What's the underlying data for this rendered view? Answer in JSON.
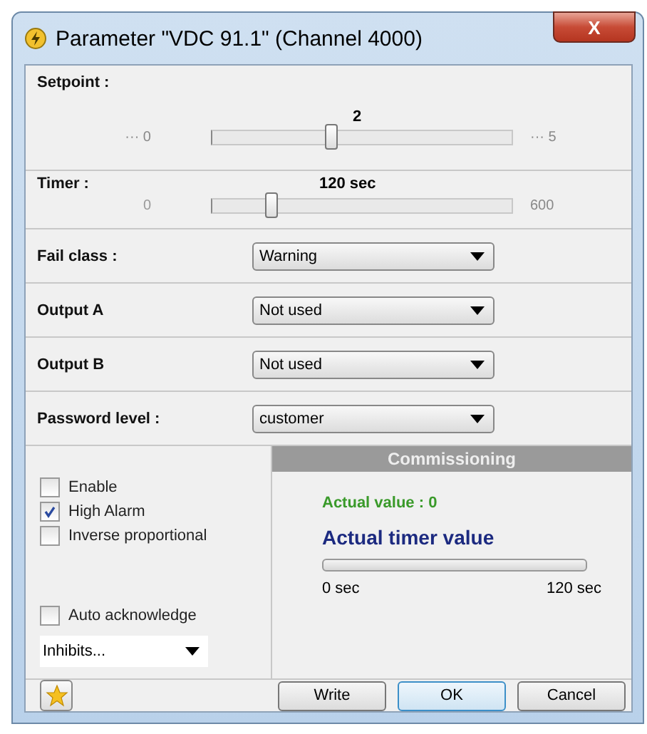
{
  "window": {
    "title": "Parameter \"VDC 91.1\" (Channel 4000)",
    "close": "X"
  },
  "setpoint": {
    "label": "Setpoint :",
    "value": "2",
    "min": "··· 0",
    "max": "··· 5",
    "level": 0.4
  },
  "timer": {
    "label": "Timer :",
    "value": "120 sec",
    "min": "0",
    "max": "600",
    "level": 0.2
  },
  "selects": [
    {
      "label": "Fail class :",
      "value": "Warning"
    },
    {
      "label": "Output A",
      "value": "Not used"
    },
    {
      "label": "Output B",
      "value": "Not used"
    },
    {
      "label": "Password level :",
      "value": "customer"
    }
  ],
  "checkboxes": [
    {
      "label": "Enable",
      "checked": false
    },
    {
      "label": "High Alarm",
      "checked": true
    },
    {
      "label": "Inverse proportional",
      "checked": false
    }
  ],
  "auto_acknowledge": {
    "label": "Auto acknowledge",
    "checked": false
  },
  "inhibits": {
    "value": "Inhibits..."
  },
  "commissioning": {
    "header": "Commissioning",
    "actual_value": "Actual value : 0",
    "timer_title": "Actual timer value",
    "level": 0,
    "min": "0 sec",
    "max": "120 sec"
  },
  "buttons": [
    {
      "label": "Write",
      "kind": "normal"
    },
    {
      "label": "OK",
      "kind": "default"
    },
    {
      "label": "Cancel",
      "kind": "normal"
    }
  ]
}
